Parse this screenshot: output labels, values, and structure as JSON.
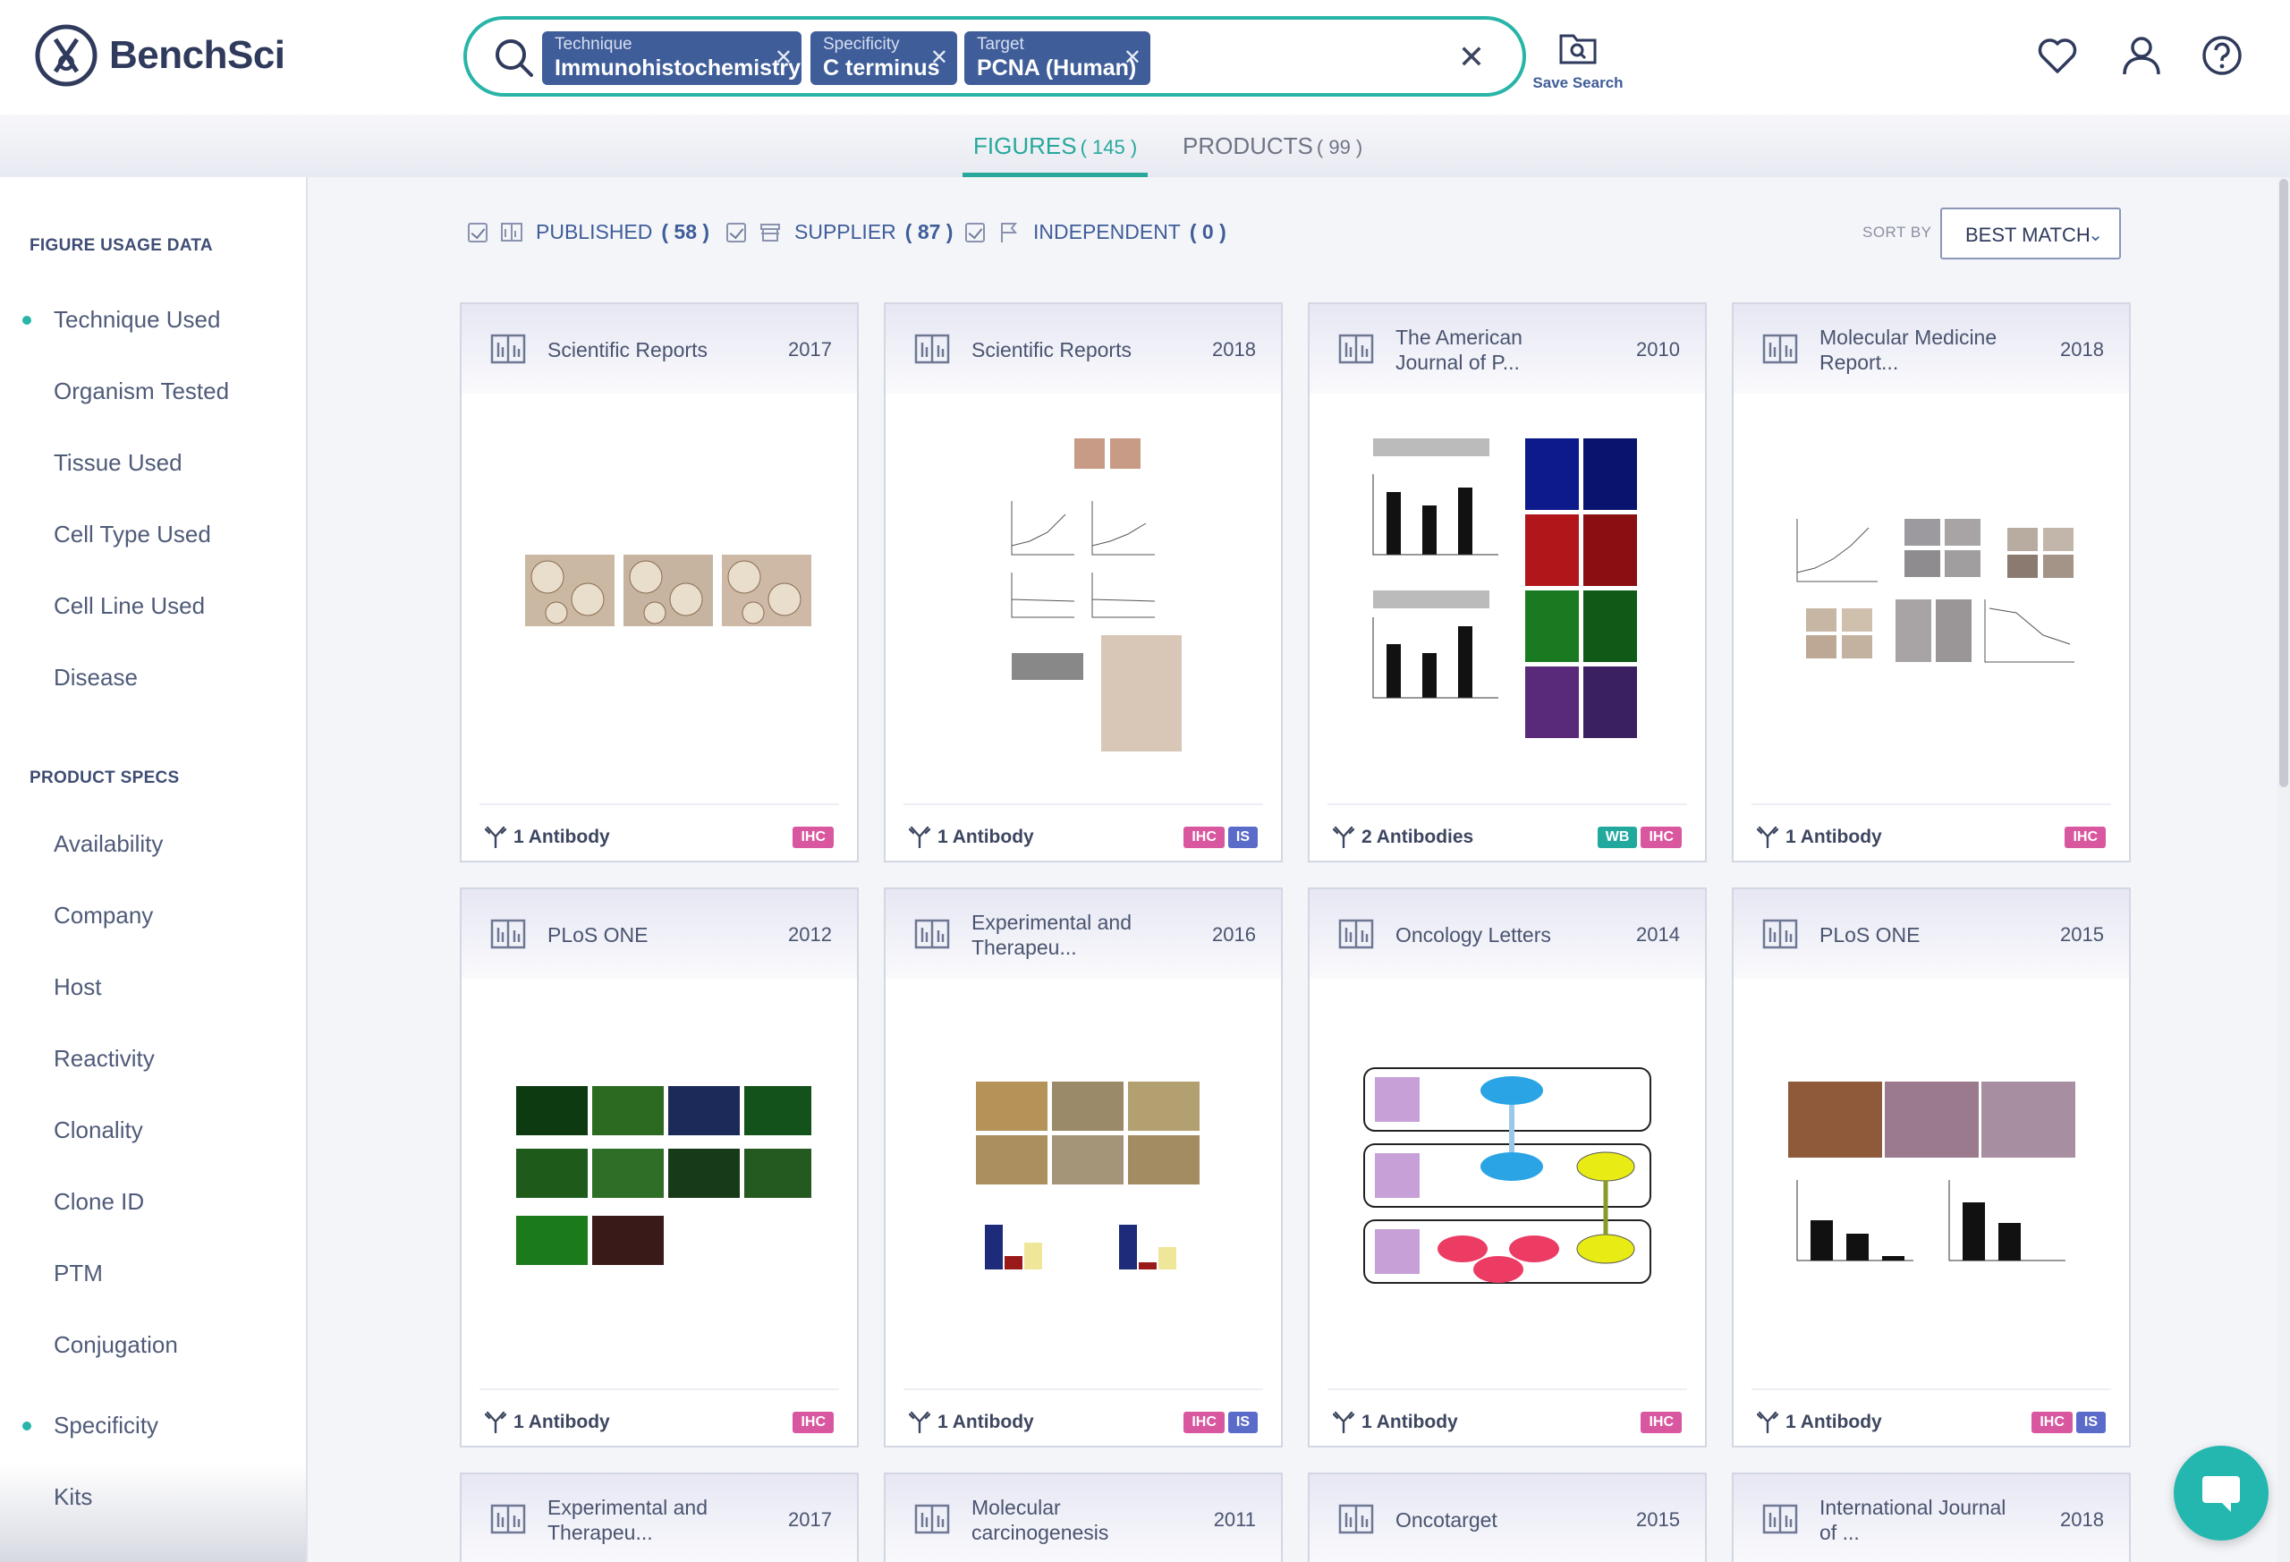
{
  "brand": {
    "name": "BenchSci"
  },
  "search": {
    "chips": [
      {
        "label": "Technique",
        "value": "Immunohistochemistry"
      },
      {
        "label": "Specificity",
        "value": "C terminus"
      },
      {
        "label": "Target",
        "value": "PCNA (Human)"
      }
    ],
    "clear_icon": "close-icon",
    "save_label": "Save Search"
  },
  "header_icons": [
    "heart-icon",
    "user-icon",
    "help-icon"
  ],
  "tabs": [
    {
      "label": "FIGURES",
      "count": "( 145 )",
      "active": true
    },
    {
      "label": "PRODUCTS",
      "count": "( 99 )",
      "active": false
    }
  ],
  "sidebar": {
    "figure_heading": "FIGURE USAGE DATA",
    "figure_items": [
      {
        "label": "Technique Used",
        "active": true
      },
      {
        "label": "Organism Tested",
        "active": false
      },
      {
        "label": "Tissue Used",
        "active": false
      },
      {
        "label": "Cell Type Used",
        "active": false
      },
      {
        "label": "Cell Line Used",
        "active": false
      },
      {
        "label": "Disease",
        "active": false
      }
    ],
    "product_heading": "PRODUCT SPECS",
    "product_items": [
      {
        "label": "Availability",
        "active": false
      },
      {
        "label": "Company",
        "active": false
      },
      {
        "label": "Host",
        "active": false
      },
      {
        "label": "Reactivity",
        "active": false
      },
      {
        "label": "Clonality",
        "active": false
      },
      {
        "label": "Clone ID",
        "active": false
      },
      {
        "label": "PTM",
        "active": false
      },
      {
        "label": "Conjugation",
        "active": false
      },
      {
        "label": "Specificity",
        "active": true
      },
      {
        "label": "Kits",
        "active": false
      }
    ]
  },
  "filters": [
    {
      "label": "PUBLISHED",
      "count": "( 58 )",
      "checked": true
    },
    {
      "label": "SUPPLIER",
      "count": "( 87 )",
      "checked": true
    },
    {
      "label": "INDEPENDENT",
      "count": "( 0 )",
      "checked": true
    }
  ],
  "sort": {
    "label": "SORT BY",
    "value": "BEST MATCH"
  },
  "badge_colors": {
    "IHC": "#d9579e",
    "IS": "#5b6bc9",
    "WB": "#22a99d"
  },
  "cards": [
    {
      "journal": "Scientific Reports",
      "year": "2017",
      "antibodies": "1 Antibody",
      "badges": [
        "IHC"
      ]
    },
    {
      "journal": "Scientific Reports",
      "year": "2018",
      "antibodies": "1 Antibody",
      "badges": [
        "IHC",
        "IS"
      ]
    },
    {
      "journal": "The American Journal of P...",
      "year": "2010",
      "antibodies": "2 Antibodies",
      "badges": [
        "WB",
        "IHC"
      ]
    },
    {
      "journal": "Molecular Medicine Report...",
      "year": "2018",
      "antibodies": "1 Antibody",
      "badges": [
        "IHC"
      ]
    },
    {
      "journal": "PLoS ONE",
      "year": "2012",
      "antibodies": "1 Antibody",
      "badges": [
        "IHC"
      ]
    },
    {
      "journal": "Experimental and Therapeu...",
      "year": "2016",
      "antibodies": "1 Antibody",
      "badges": [
        "IHC",
        "IS"
      ]
    },
    {
      "journal": "Oncology Letters",
      "year": "2014",
      "antibodies": "1 Antibody",
      "badges": [
        "IHC"
      ]
    },
    {
      "journal": "PLoS ONE",
      "year": "2015",
      "antibodies": "1 Antibody",
      "badges": [
        "IHC",
        "IS"
      ]
    },
    {
      "journal": "Experimental and Therapeu...",
      "year": "2017"
    },
    {
      "journal": "Molecular carcinogenesis",
      "year": "2011"
    },
    {
      "journal": "Oncotarget",
      "year": "2015"
    },
    {
      "journal": "International Journal of ...",
      "year": "2018"
    }
  ],
  "chat": {
    "icon": "chat-icon"
  }
}
